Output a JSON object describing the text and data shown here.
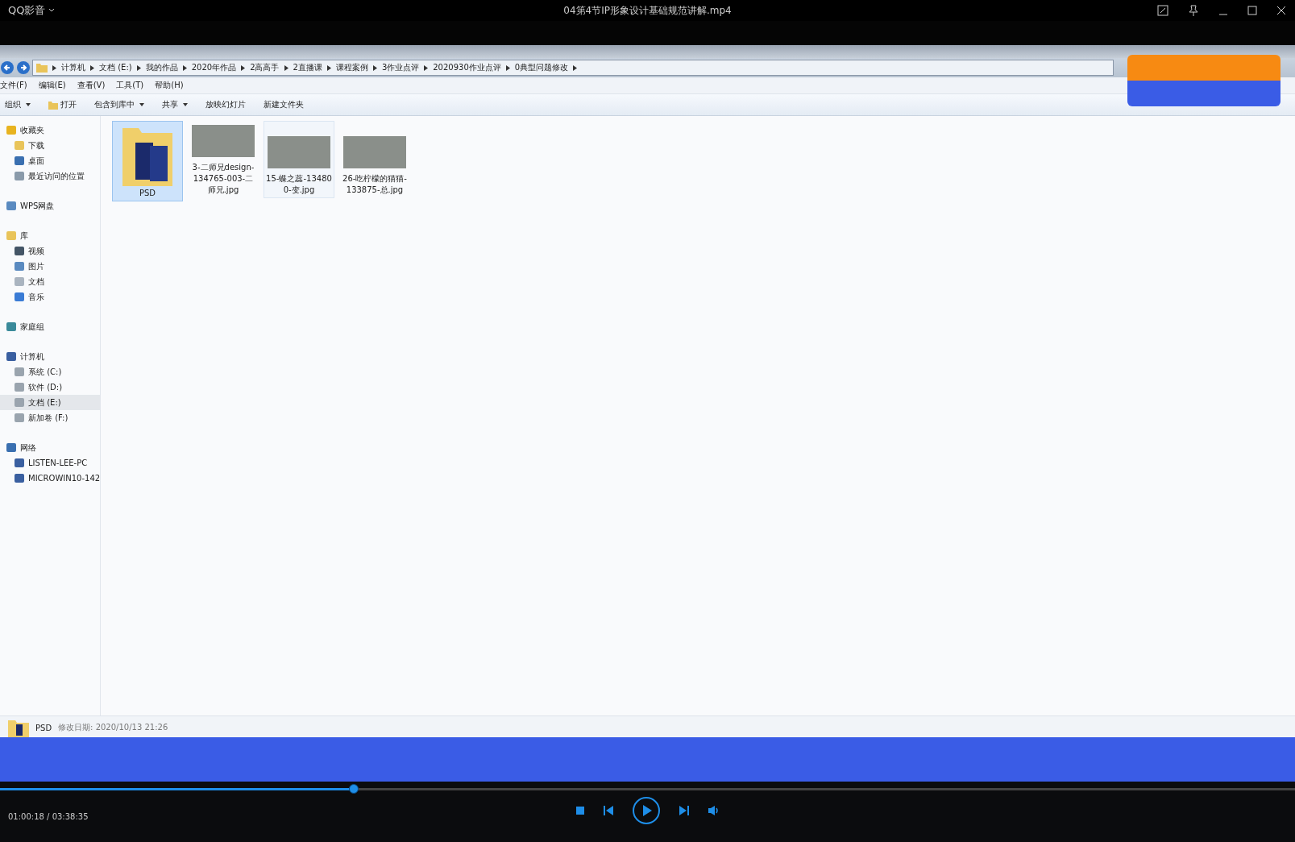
{
  "player": {
    "app_name": "QQ影音",
    "title": "04第4节IP形象设计基础规范讲解.mp4"
  },
  "explorer": {
    "breadcrumb": [
      "计算机",
      "文档 (E:)",
      "我的作品",
      "2020年作品",
      "2高高手",
      "2直播课",
      "课程案例",
      "3作业点评",
      "2020930作业点评",
      "0典型问题修改"
    ],
    "menu": [
      "文件(F)",
      "编辑(E)",
      "查看(V)",
      "工具(T)",
      "帮助(H)"
    ],
    "toolbar": [
      {
        "label": "组织",
        "has_menu": true,
        "kind": "plain"
      },
      {
        "label": "打开",
        "has_menu": false,
        "kind": "open"
      },
      {
        "label": "包含到库中",
        "has_menu": true,
        "kind": "plain"
      },
      {
        "label": "共享",
        "has_menu": true,
        "kind": "plain"
      },
      {
        "label": "放映幻灯片",
        "has_menu": false,
        "kind": "plain"
      },
      {
        "label": "新建文件夹",
        "has_menu": false,
        "kind": "plain"
      }
    ],
    "sidebar": [
      {
        "label": "收藏夹",
        "kind": "star",
        "selected": false,
        "children": [
          {
            "label": "下载",
            "kind": "folder",
            "selected": false
          },
          {
            "label": "桌面",
            "kind": "desktop",
            "selected": false
          },
          {
            "label": "最近访问的位置",
            "kind": "recent",
            "selected": false
          }
        ]
      },
      {
        "label": "WPS网盘",
        "kind": "cloud",
        "selected": false
      },
      {
        "label": "库",
        "kind": "folder",
        "selected": false,
        "children": [
          {
            "label": "视频",
            "kind": "video",
            "selected": false
          },
          {
            "label": "图片",
            "kind": "picture",
            "selected": false
          },
          {
            "label": "文档",
            "kind": "document",
            "selected": false
          },
          {
            "label": "音乐",
            "kind": "music",
            "selected": false
          }
        ]
      },
      {
        "label": "家庭组",
        "kind": "group",
        "selected": false
      },
      {
        "label": "计算机",
        "kind": "computer",
        "selected": false,
        "children": [
          {
            "label": "系统 (C:)",
            "kind": "drive",
            "selected": false
          },
          {
            "label": "软件 (D:)",
            "kind": "drive",
            "selected": false
          },
          {
            "label": "文档 (E:)",
            "kind": "drive",
            "selected": true
          },
          {
            "label": "新加卷 (F:)",
            "kind": "drive",
            "selected": false
          }
        ]
      },
      {
        "label": "网络",
        "kind": "network",
        "selected": false,
        "children": [
          {
            "label": "LISTEN-LEE-PC",
            "kind": "computer",
            "selected": false
          },
          {
            "label": "MICROWIN10-142",
            "kind": "computer",
            "selected": false
          }
        ]
      }
    ],
    "files": [
      {
        "name": "PSD",
        "kind": "folder",
        "selected": true,
        "hovered": false
      },
      {
        "name": "3-二师兄design-134765-003-二师兄.jpg",
        "kind": "image",
        "selected": false,
        "hovered": false
      },
      {
        "name": "15-蝶之蕊-134800-变.jpg",
        "kind": "image",
        "selected": false,
        "hovered": true
      },
      {
        "name": "26-吃柠檬的猫猫-133875-总.jpg",
        "kind": "image",
        "selected": false,
        "hovered": false
      }
    ],
    "status": {
      "name": "PSD",
      "detail": "修改日期: 2020/10/13 21:26"
    }
  },
  "playback": {
    "level": 0.273,
    "time": "01:00:18 / 03:38:35"
  }
}
